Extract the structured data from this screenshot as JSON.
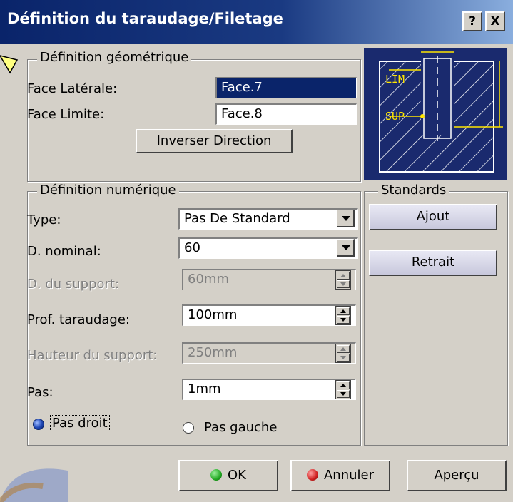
{
  "window": {
    "title": "Définition du taraudage/Filetage",
    "help_label": "?",
    "close_label": "X"
  },
  "geometric": {
    "legend": "Définition géométrique",
    "face_laterale_label": "Face Latérale:",
    "face_laterale_value": "Face.7",
    "face_limite_label": "Face Limite:",
    "face_limite_value": "Face.8",
    "inverser_label": "Inverser Direction"
  },
  "preview": {
    "lim_label": "LIM",
    "sup_label": "SUP"
  },
  "numeric": {
    "legend": "Définition numérique",
    "type_label": "Type:",
    "type_value": "Pas De Standard",
    "nominal_label": "D. nominal:",
    "nominal_value": "60",
    "support_label": "D. du support:",
    "support_value": "60mm",
    "prof_label": "Prof. taraudage:",
    "prof_value": "100mm",
    "hauteur_label": "Hauteur du support:",
    "hauteur_value": "250mm",
    "pas_label": "Pas:",
    "pas_value": "1mm",
    "pas_droit_label": "Pas droit",
    "pas_gauche_label": "Pas gauche",
    "pas_droit_selected": true
  },
  "standards": {
    "legend": "Standards",
    "ajout_label": "Ajout",
    "retrait_label": "Retrait"
  },
  "footer": {
    "ok_label": "OK",
    "annuler_label": "Annuler",
    "apercu_label": "Aperçu"
  },
  "colors": {
    "title_bar": "#0a246a",
    "dialog_bg": "#d4d0c8",
    "preview_bg": "#1a2a6e",
    "preview_accent": "#ffe600",
    "ok_ball": "#22a822",
    "cancel_ball": "#d02020"
  }
}
